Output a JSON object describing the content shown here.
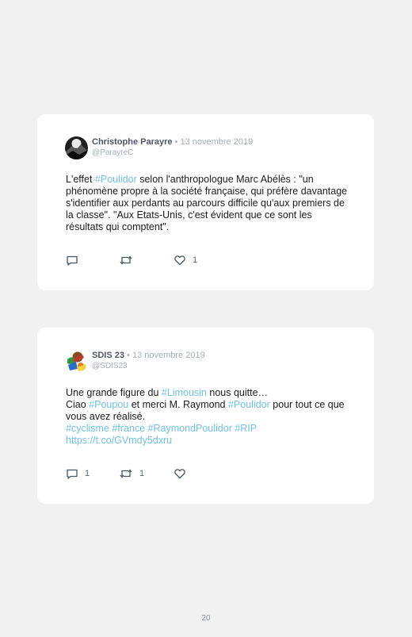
{
  "tweets": [
    {
      "name": "Christophe Parayre",
      "separator": "•",
      "date": "13 novembre 2019",
      "handle": "@ParayreC",
      "avatar_icon": "dark-landscape-avatar",
      "body": [
        {
          "text": "L'effet ",
          "type": "text"
        },
        {
          "text": "#Poulidor",
          "type": "tag"
        },
        {
          "text": " selon l'anthropologue Marc Abélès : \"un phénomène propre à la société française, qui préfère davantage s'identifier aux perdants au parcours difficile qu'aux premiers de la classe\". \"Aux Etats-Unis, c'est évident que ce sont les résultats qui comptent\".",
          "type": "text"
        }
      ],
      "replies": "",
      "retweets": "",
      "likes": "1"
    },
    {
      "name": "SDIS 23",
      "separator": "•",
      "date": "13 novembre 2019",
      "handle": "@SDIS23",
      "avatar_icon": "fire-brigade-logo-avatar",
      "body_lines": [
        [
          {
            "text": "Une grande figure du ",
            "type": "text"
          },
          {
            "text": "#Limousin",
            "type": "tag"
          },
          {
            "text": " nous quitte…",
            "type": "text"
          }
        ],
        [
          {
            "text": "Ciao ",
            "type": "text"
          },
          {
            "text": "#Poupou",
            "type": "tag"
          },
          {
            "text": " et merci M. Raymond ",
            "type": "text"
          },
          {
            "text": "#Poulidor",
            "type": "tag"
          },
          {
            "text": " pour tout ce que vous avez réalisé.",
            "type": "text"
          }
        ],
        [
          {
            "text": "#cyclisme",
            "type": "tag"
          },
          {
            "text": " ",
            "type": "text"
          },
          {
            "text": "#france",
            "type": "tag"
          },
          {
            "text": " ",
            "type": "text"
          },
          {
            "text": "#RaymondPoulidor",
            "type": "tag"
          },
          {
            "text": " ",
            "type": "text"
          },
          {
            "text": "#RIP",
            "type": "tag"
          }
        ],
        [
          {
            "text": "https://t.co/GVmdy5dxru",
            "type": "tag"
          }
        ]
      ],
      "replies": "1",
      "retweets": "1",
      "likes": ""
    }
  ],
  "page_number": "20",
  "colors": {
    "hashtag": "#6ec1e4",
    "background": "#f1f1f1",
    "card": "#ffffff"
  }
}
